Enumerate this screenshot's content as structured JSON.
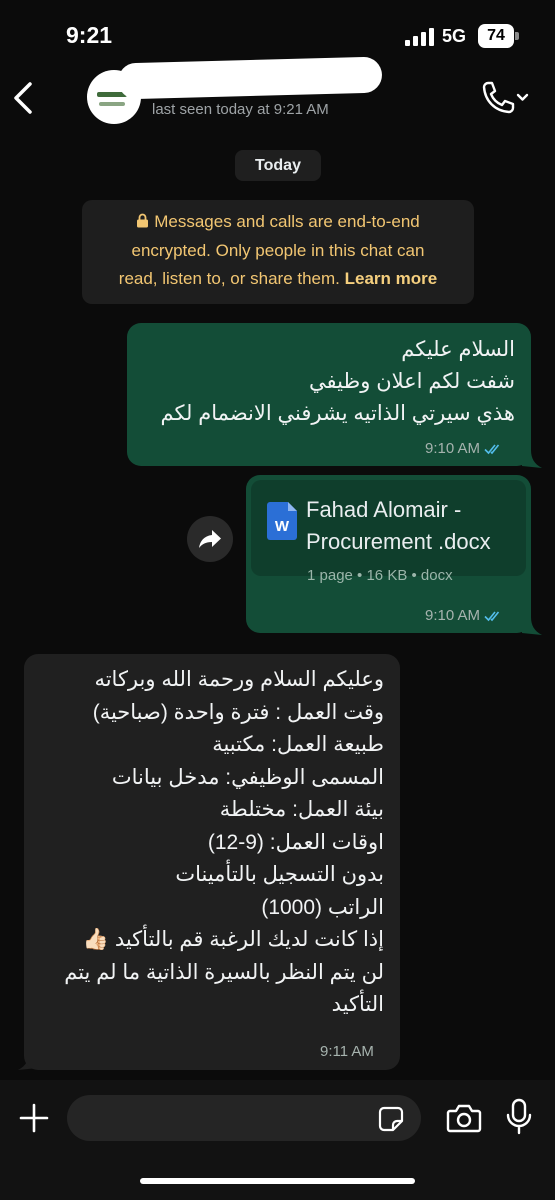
{
  "status_bar": {
    "time": "9:21",
    "network": "5G",
    "battery": "74"
  },
  "header": {
    "last_seen": "last seen today at 9:21 AM"
  },
  "chat": {
    "date_chip": "Today",
    "encryption": {
      "line1": "Messages and calls are end-to-end",
      "line2": "encrypted. Only people in this chat can",
      "line3": "read, listen to, or share them.",
      "learn_more": "Learn more"
    },
    "messages": [
      {
        "direction": "outgoing",
        "lines": [
          "السلام عليكم",
          "شفت لكم اعلان وظيفي",
          "هذي سيرتي الذاتيه يشرفني الانضمام لكم"
        ],
        "time": "9:10 AM"
      },
      {
        "direction": "outgoing",
        "document": {
          "name_line1": "Fahad Alomair -",
          "name_line2": "Procurement .docx",
          "info": "1 page • 16 KB • docx",
          "icon_letter": "W"
        },
        "time": "9:10 AM"
      },
      {
        "direction": "incoming",
        "lines": [
          "وعليكم السلام ورحمة الله وبركاته",
          "وقت العمل : فترة واحدة (صباحية)",
          "طبيعة العمل: مكتبية",
          "المسمى الوظيفي: مدخل بيانات",
          "بيئة العمل: مختلطة",
          "اوقات العمل: (9-12)",
          "بدون التسجيل بالتأمينات",
          "الراتب (1000)",
          "إذا كانت لديك الرغبة قم بالتأكيد 👍🏻",
          "لن يتم النظر بالسيرة الذاتية ما لم يتم",
          "التأكيد"
        ],
        "time": "9:11 AM"
      }
    ]
  },
  "colors": {
    "outgoing_bubble": "#134d37",
    "incoming_bubble": "#202020",
    "encryption_text": "#f2c672",
    "read_ticks": "#53bdeb"
  },
  "icons": [
    "back-chevron-icon",
    "phone-icon",
    "chevron-down-icon",
    "lock-icon",
    "word-doc-icon",
    "forward-icon",
    "double-check-icon",
    "plus-icon",
    "sticker-icon",
    "camera-icon",
    "microphone-icon"
  ]
}
